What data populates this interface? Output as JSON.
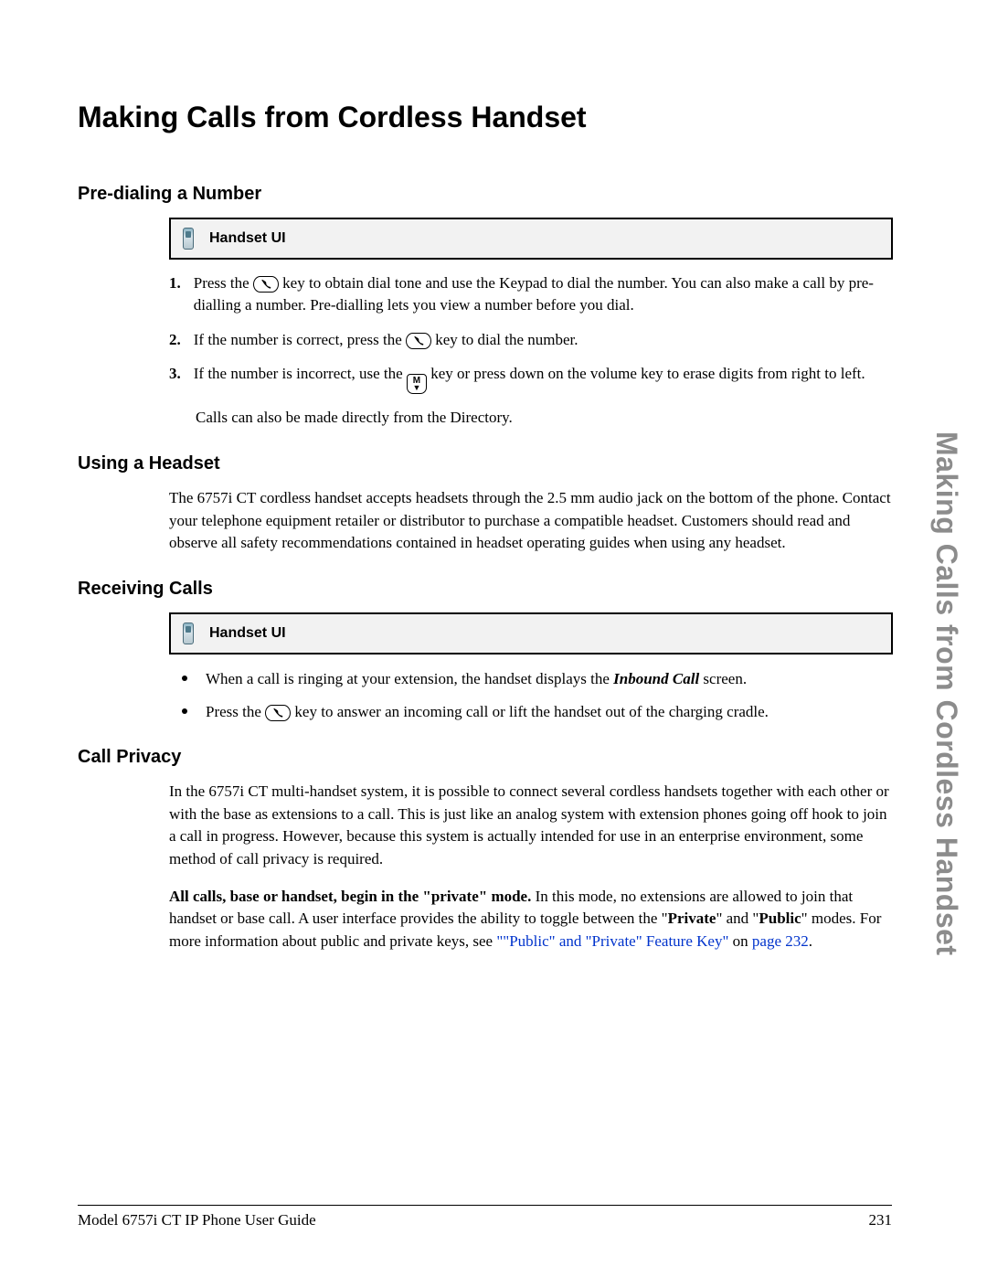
{
  "title": "Making Calls from Cordless Handset",
  "sideText": "Making Calls from Cordless Handset",
  "handsetUiLabel": "Handset UI",
  "sections": {
    "predial": {
      "heading": "Pre-dialing a Number",
      "items": [
        {
          "num": "1.",
          "before": "Press the ",
          "afterKey": " key to obtain dial tone and use the Keypad to dial the number. You can also make a call by pre-dialling a number. Pre-dialling lets you view a number before you dial."
        },
        {
          "num": "2.",
          "before": "If the number is correct, press the ",
          "afterKey": " key to dial the number."
        },
        {
          "num": "3.",
          "before": "If the number is incorrect, use the ",
          "afterKey": " key or press down on the volume key to erase digits from right to left."
        }
      ],
      "trailing": "Calls can also be made directly from the Directory."
    },
    "headset": {
      "heading": "Using a Headset",
      "para": "The 6757i CT cordless handset accepts headsets through the 2.5 mm audio jack on the bottom of the phone. Contact your telephone equipment retailer or distributor to purchase a compatible headset. Customers should read and observe all safety recommendations contained in headset operating guides when using any headset."
    },
    "receiving": {
      "heading": "Receiving Calls",
      "items": [
        {
          "pre": "When a call is ringing at your extension, the handset displays the ",
          "em": "Inbound Call",
          "post": " screen."
        },
        {
          "pre": "Press the ",
          "post": " key to answer an incoming call or lift the handset out of the charging cradle."
        }
      ]
    },
    "privacy": {
      "heading": "Call Privacy",
      "para1": "In the 6757i CT multi-handset system, it is possible to connect several cordless handsets together with each other or with the base as extensions to a call. This is just like an analog system with extension phones going off hook to join a call in progress. However, because this system is actually intended for use in an enterprise environment, some method of call privacy is required.",
      "para2": {
        "bold1": "All calls, base or handset, begin in the \"private\" mode.",
        "t1": " In this mode, no extensions are allowed to join that handset or base call. A user interface provides the ability to toggle between the \"",
        "bold2": "Private",
        "t2": "\" and \"",
        "bold3": "Public",
        "t3": "\" modes. For more information about public and private keys, see ",
        "link1": "\"\"Public\" and \"Private\" Feature Key\"",
        "t4": " on ",
        "link2": "page 232",
        "t5": "."
      }
    }
  },
  "footer": {
    "left": "Model 6757i CT IP Phone User Guide",
    "right": "231"
  }
}
